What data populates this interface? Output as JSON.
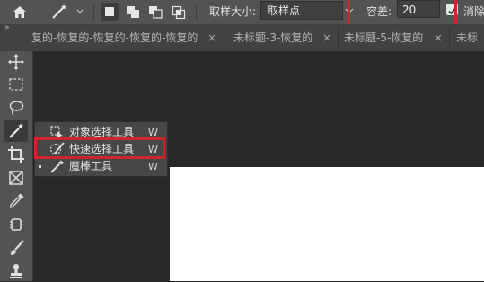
{
  "options_bar": {
    "sample_size_label": "取样大小:",
    "sample_size_value": "取样点",
    "tolerance_label": "容差:",
    "tolerance_value": "20",
    "antialias_label": "消除"
  },
  "tabs": [
    {
      "label": "复的-恢复的-恢复的-恢复的-恢复的"
    },
    {
      "label": "未标题-3-恢复的"
    },
    {
      "label": "未标题-5-恢复的"
    },
    {
      "label": "未标"
    }
  ],
  "tab_close_glyph": "×",
  "tools": [
    "move-icon",
    "marquee-icon",
    "lasso-icon",
    "magic-wand-icon",
    "crop-icon",
    "frame-icon",
    "eyedropper-icon",
    "healing-brush-icon",
    "brush-icon",
    "clone-stamp-icon"
  ],
  "flyout": {
    "items": [
      {
        "label": "对象选择工具",
        "shortcut": "W",
        "icon": "object-selection-icon"
      },
      {
        "label": "快速选择工具",
        "shortcut": "W",
        "icon": "quick-selection-icon"
      },
      {
        "label": "魔棒工具",
        "shortcut": "W",
        "icon": "magic-wand-icon"
      }
    ]
  },
  "colors": {
    "highlight": "#d2232a",
    "panel": "#535353",
    "workspace": "#282828",
    "document": "#ffffff"
  }
}
